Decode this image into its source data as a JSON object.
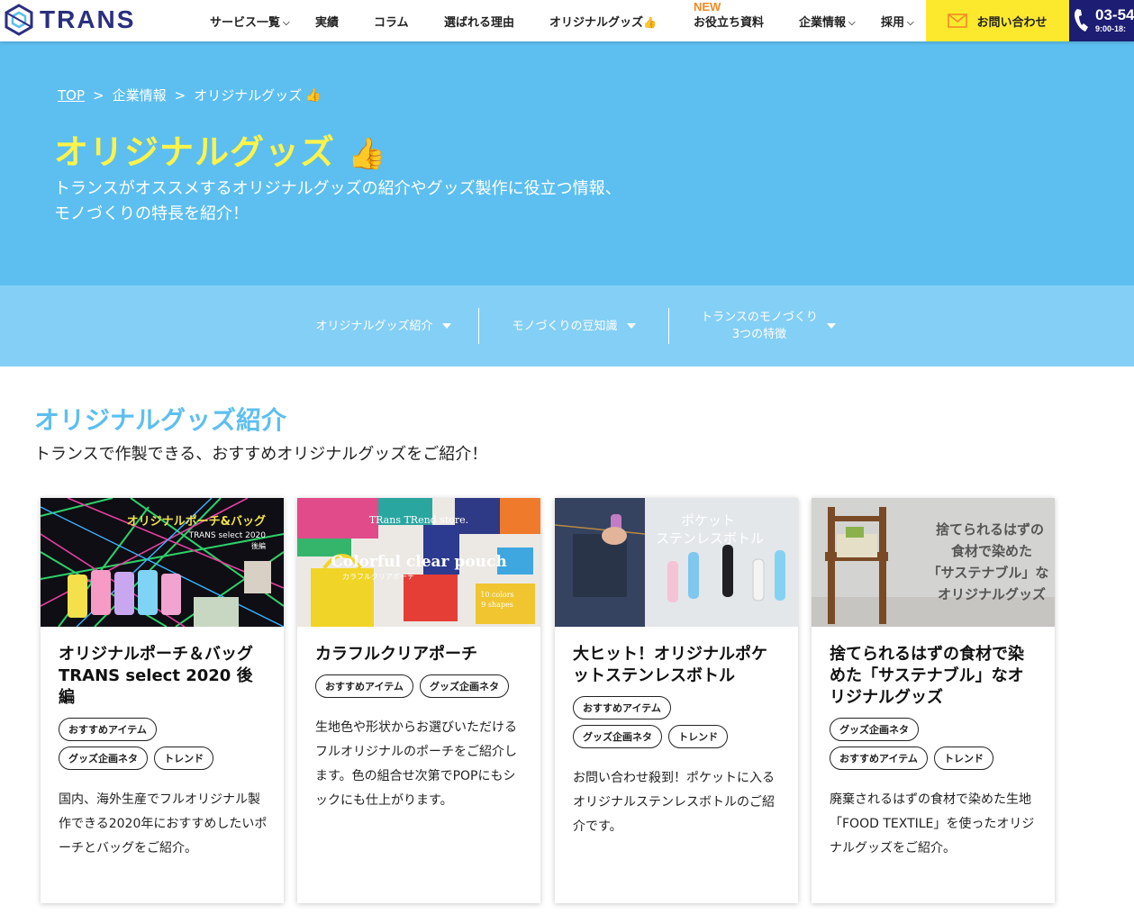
{
  "header": {
    "logo_text": "TRANS",
    "nav": [
      {
        "label": "サービス一覧",
        "has_dropdown": true
      },
      {
        "label": "実績"
      },
      {
        "label": "コラム"
      },
      {
        "label": "選ばれる理由"
      },
      {
        "label": "オリジナルグッズ",
        "icon": "thumbs-up-icon"
      },
      {
        "label": "お役立ち資料",
        "badge": "NEW"
      },
      {
        "label": "企業情報",
        "has_dropdown": true
      },
      {
        "label": "採用",
        "has_dropdown": true
      }
    ],
    "contact_label": "お問い合わせ",
    "tel_number": "03-54",
    "tel_hours": "9:00-18:"
  },
  "hero": {
    "breadcrumb": [
      "TOP",
      "企業情報",
      "オリジナルグッズ"
    ],
    "title": "オリジナルグッズ",
    "description_line1": "トランスがオススメするオリジナルグッズの紹介やグッズ製作に役立つ情報、",
    "description_line2": "モノづくりの特長を紹介！"
  },
  "subnav": [
    {
      "label": "オリジナルグッズ紹介"
    },
    {
      "label": "モノづくりの豆知識"
    },
    {
      "label_line1": "トランスのモノづくり",
      "label_line2": "3つの特徴"
    }
  ],
  "section": {
    "title": "オリジナルグッズ紹介",
    "subtitle": "トランスで作製できる、おすすめオリジナルグッズをご紹介！"
  },
  "cards": [
    {
      "title": "オリジナルポーチ＆バッグ TRANS select 2020 後編",
      "image_text": {
        "line1": "オリジナルポーチ&バッグ",
        "line2": "TRANS select 2020",
        "line3": "後編"
      },
      "tags": [
        "おすすめアイテム",
        "グッズ企画ネタ",
        "トレンド"
      ],
      "description": "国内、海外生産でフルオリジナル製作できる2020年におすすめしたいポーチとバッグをご紹介。"
    },
    {
      "title": "カラフルクリアポーチ",
      "image_text": {
        "line1": "TRans TRend store.",
        "line2": "Colorful clear pouch",
        "line3": "カラフルクリアポーチ",
        "line4": "10 colors",
        "line5": "9 shapes"
      },
      "tags": [
        "おすすめアイテム",
        "グッズ企画ネタ"
      ],
      "description": "生地色や形状からお選びいただけるフルオリジナルのポーチをご紹介します。色の組合せ次第でPOPにもシックにも仕上がります。"
    },
    {
      "title": "大ヒット！オリジナルポケットステンレスボトル",
      "image_text": {
        "line1": "ポケット",
        "line2": "ステンレスボトル"
      },
      "tags": [
        "おすすめアイテム",
        "グッズ企画ネタ",
        "トレンド"
      ],
      "description": "お問い合わせ殺到！ポケットに入るオリジナルステンレスボトルのご紹介です。"
    },
    {
      "title": "捨てられるはずの食材で染めた「サステナブル」なオリジナルグッズ",
      "image_text": {
        "line1": "捨てられるはずの",
        "line2": "食材で染めた",
        "line3": "「サステナブル」な",
        "line4": "オリジナルグッズ"
      },
      "tags": [
        "グッズ企画ネタ",
        "おすすめアイテム",
        "トレンド"
      ],
      "description": "廃棄されるはずの食材で染めた生地「FOOD TEXTILE」を使ったオリジナルグッズをご紹介。"
    }
  ],
  "colors": {
    "brand_navy": "#2b2f80",
    "hero_bg": "#5dbfef",
    "subnav_bg": "#84cff5",
    "title_yellow": "#fff34a",
    "contact_yellow": "#fce92e",
    "new_orange": "#f08a24"
  }
}
